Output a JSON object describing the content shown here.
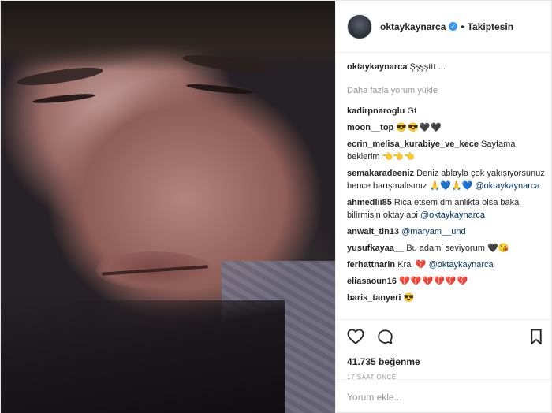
{
  "post": {
    "username": "oktaykaynarca",
    "follow_status": "Takiptesin",
    "separator": "•",
    "caption_text": "Şşşşttt ...",
    "load_more": "Daha fazla yorum yükle",
    "likes": "41.735 beğenme",
    "time": "17 SAAT ÖNCE",
    "comment_placeholder": "Yorum ekle..."
  },
  "comments": [
    {
      "user": "kadirpnaroglu",
      "text": "Gt"
    },
    {
      "user": "moon__top",
      "text": "😎😎🖤🖤"
    },
    {
      "user": "ecrin_melisa_kurabiye_ve_kece",
      "text": "Sayfama beklerim 👈👈👈"
    },
    {
      "user": "semakaradeeniz",
      "text": "Deniz ablayla çok yakışıyorsunuz bence barışmalısınız 🙏💙🙏💙",
      "mention": "@oktaykaynarca"
    },
    {
      "user": "ahmedlii85",
      "text": "Rica etsem dm anlikta olsa baka bilirmisin oktay abi",
      "mention": "@oktaykaynarca"
    },
    {
      "user": "anwalt_tin13",
      "text": "",
      "mention": "@maryam__und"
    },
    {
      "user": "yusufkayaa__",
      "text": "Bu adami seviyorum 🖤😘"
    },
    {
      "user": "ferhattnarin",
      "text": "Kral 💔",
      "mention": "@oktaykaynarca"
    },
    {
      "user": "eliasaoun16",
      "text": "💔💔💔💔💔💔"
    },
    {
      "user": "baris_tanyeri",
      "text": "😎"
    }
  ],
  "icons": [
    "heart-icon",
    "comment-icon",
    "bookmark-icon"
  ]
}
